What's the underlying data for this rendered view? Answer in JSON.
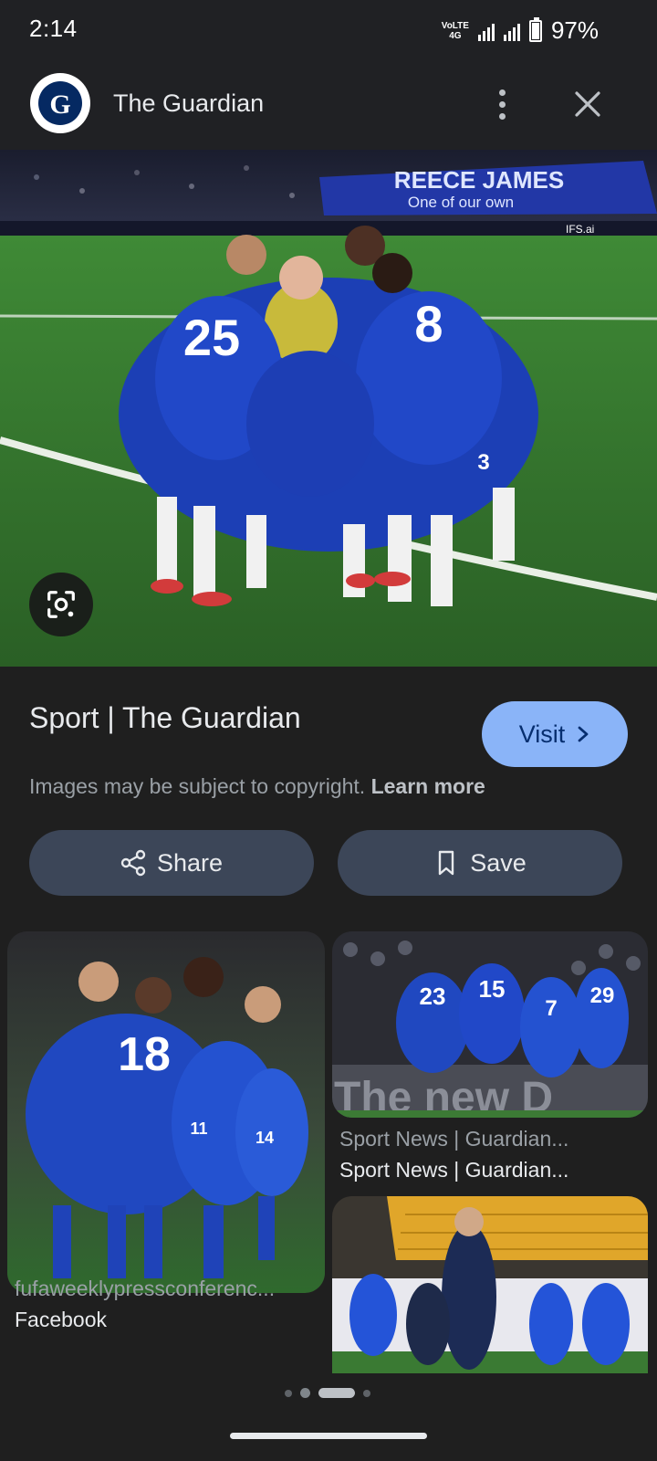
{
  "status_bar": {
    "time": "2:14",
    "net_top": "VoLTE",
    "net_bottom": "4G",
    "battery": "97%"
  },
  "header": {
    "logo_letter": "G",
    "title": "The Guardian"
  },
  "hero": {
    "banner_line1": "REECE JAMES",
    "banner_line2": "One of our own",
    "jersey_numbers": [
      "25",
      "8",
      "3"
    ],
    "sponsor_label": "IFS.ai"
  },
  "result": {
    "title": "Sport | The Guardian",
    "visit_label": "Visit",
    "copyright_text": "Images may be subject to copyright.",
    "learn_more": "Learn more"
  },
  "actions": {
    "share_label": "Share",
    "save_label": "Save"
  },
  "related": [
    {
      "source": "fufaweeklypressconferenc...",
      "title": "Facebook",
      "jersey_numbers": [
        "18",
        "11",
        "14"
      ]
    },
    {
      "source": "Sport News | Guardian...",
      "title": "Sport News | Guardian...",
      "jersey_numbers": [
        "23",
        "15",
        "7",
        "29"
      ],
      "overlay_text": "The new D"
    },
    {
      "source": "",
      "title": "",
      "jersey_numbers": []
    }
  ],
  "colors": {
    "background": "#1f1f1f",
    "accent": "#8ab4f8",
    "button_bg": "#3c4658",
    "chelsea_blue": "#1a3fc0",
    "pitch_green": "#2f6e2c"
  }
}
